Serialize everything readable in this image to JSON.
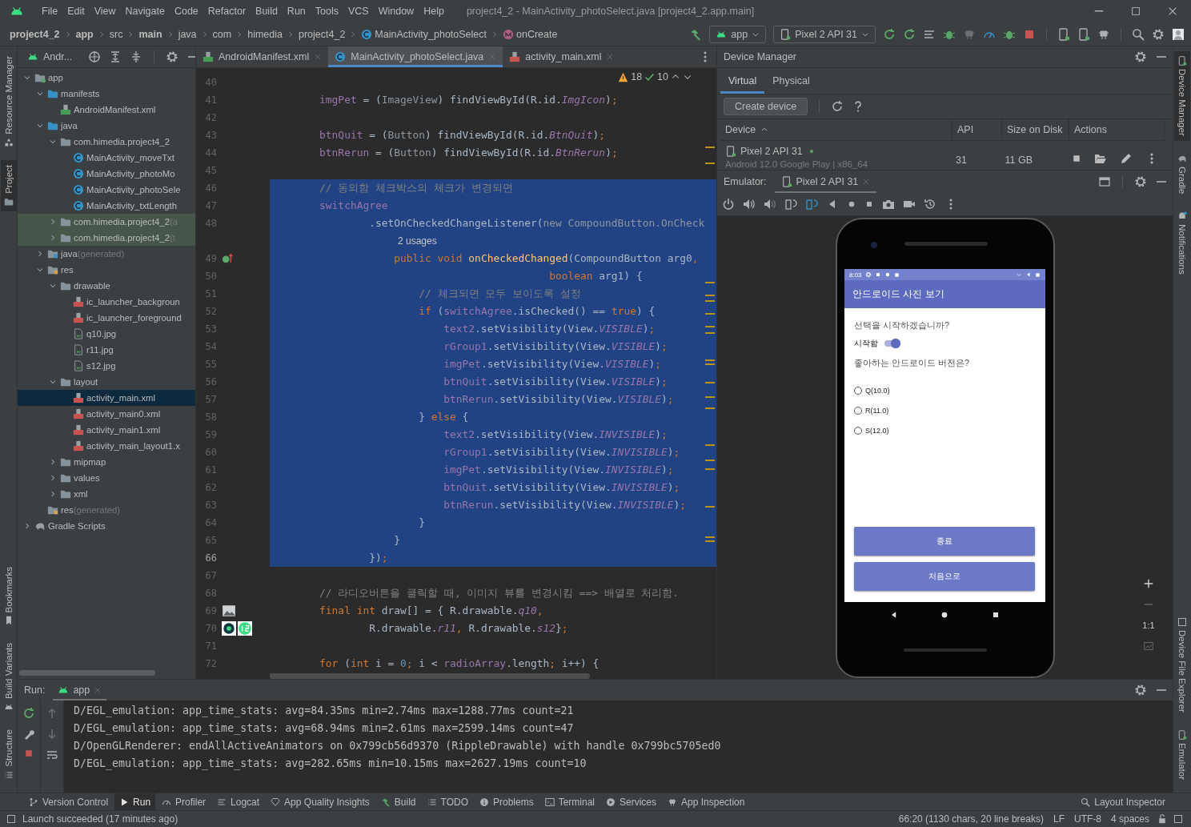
{
  "window": {
    "title": "project4_2 - MainActivity_photoSelect.java [project4_2.app.main]"
  },
  "menu": [
    "File",
    "Edit",
    "View",
    "Navigate",
    "Code",
    "Refactor",
    "Build",
    "Run",
    "Tools",
    "VCS",
    "Window",
    "Help"
  ],
  "breadcrumbs": [
    {
      "kind": "project",
      "label": "project4_2"
    },
    {
      "kind": "folder",
      "label": "app"
    },
    {
      "kind": "folder",
      "label": "src"
    },
    {
      "kind": "folder",
      "label": "main"
    },
    {
      "kind": "folder",
      "label": "java"
    },
    {
      "kind": "folder",
      "label": "com"
    },
    {
      "kind": "folder",
      "label": "himedia"
    },
    {
      "kind": "folder",
      "label": "project4_2"
    },
    {
      "kind": "class",
      "label": "MainActivity_photoSelect"
    },
    {
      "kind": "method",
      "label": "onCreate"
    }
  ],
  "toolbar": {
    "run_config": "app",
    "device": "Pixel 2 API 31"
  },
  "left_stripe": [
    {
      "label": "Resource Manager",
      "selected": false
    },
    {
      "label": "Project",
      "selected": true
    },
    {
      "label": "Bookmarks",
      "selected": false
    },
    {
      "label": "Build Variants",
      "selected": false
    },
    {
      "label": "Structure",
      "selected": false
    }
  ],
  "right_stripe": [
    {
      "label": "Device Manager",
      "selected": true
    },
    {
      "label": "Gradle",
      "selected": false
    },
    {
      "label": "Notifications",
      "selected": false
    },
    {
      "label": "Device File Explorer",
      "selected": false
    },
    {
      "label": "Emulator",
      "selected": false
    }
  ],
  "project": {
    "title": "Andr...",
    "tree": [
      {
        "label": "app",
        "kind": "module",
        "expanded": true,
        "selected": false,
        "children": [
          {
            "label": "manifests",
            "kind": "source-folder",
            "expanded": true,
            "selected": false,
            "children": [
              {
                "label": "AndroidManifest.xml",
                "kind": "manifest",
                "selected": false
              }
            ]
          },
          {
            "label": "java",
            "kind": "source-folder",
            "expanded": true,
            "selected": false,
            "children": [
              {
                "label": "com.himedia.project4_2",
                "kind": "package",
                "expanded": true,
                "selected": false,
                "tinted": false,
                "children": [
                  {
                    "label": "MainActivity_moveTxt",
                    "kind": "class",
                    "selected": false
                  },
                  {
                    "label": "MainActivity_photoMo",
                    "kind": "class",
                    "selected": false
                  },
                  {
                    "label": "MainActivity_photoSele",
                    "kind": "class",
                    "selected": false
                  },
                  {
                    "label": "MainActivity_txtLength",
                    "kind": "class",
                    "selected": false
                  }
                ]
              },
              {
                "label": "com.himedia.project4_2",
                "hint": "(a",
                "kind": "package",
                "expanded": false,
                "selected": false,
                "tinted": true
              },
              {
                "label": "com.himedia.project4_2",
                "hint": "(t",
                "kind": "package",
                "expanded": false,
                "selected": false,
                "tinted": true
              }
            ]
          },
          {
            "label": "java",
            "hint": "(generated)",
            "kind": "generated-folder",
            "expanded": false,
            "selected": false
          },
          {
            "label": "res",
            "kind": "res-folder",
            "expanded": true,
            "selected": false,
            "children": [
              {
                "label": "drawable",
                "kind": "package",
                "expanded": true,
                "selected": false,
                "children": [
                  {
                    "label": "ic_launcher_backgroun",
                    "kind": "layout-file",
                    "selected": false
                  },
                  {
                    "label": "ic_launcher_foreground",
                    "kind": "layout-file",
                    "selected": false
                  },
                  {
                    "label": "q10.jpg",
                    "kind": "image-file",
                    "selected": false
                  },
                  {
                    "label": "r11.jpg",
                    "kind": "image-file",
                    "selected": false
                  },
                  {
                    "label": "s12.jpg",
                    "kind": "image-file",
                    "selected": false
                  }
                ]
              },
              {
                "label": "layout",
                "kind": "package",
                "expanded": true,
                "selected": false,
                "children": [
                  {
                    "label": "activity_main.xml",
                    "kind": "layout-file",
                    "selected": true
                  },
                  {
                    "label": "activity_main0.xml",
                    "kind": "layout-file",
                    "selected": false
                  },
                  {
                    "label": "activity_main1.xml",
                    "kind": "layout-file",
                    "selected": false
                  },
                  {
                    "label": "activity_main_layout1.x",
                    "kind": "layout-file",
                    "selected": false
                  }
                ]
              },
              {
                "label": "mipmap",
                "kind": "package",
                "expanded": false,
                "selected": false
              },
              {
                "label": "values",
                "kind": "package",
                "expanded": false,
                "selected": false
              },
              {
                "label": "xml",
                "kind": "package",
                "expanded": false,
                "selected": false
              }
            ]
          },
          {
            "label": "res",
            "hint": "(generated)",
            "kind": "res-folder",
            "selected": false
          }
        ]
      },
      {
        "label": "Gradle Scripts",
        "kind": "gradle",
        "expanded": false,
        "selected": false
      }
    ]
  },
  "editor": {
    "tabs": [
      {
        "label": "AndroidManifest.xml",
        "kind": "manifest",
        "selected": false
      },
      {
        "label": "MainActivity_photoSelect.java",
        "kind": "class",
        "selected": true
      },
      {
        "label": "activity_main.xml",
        "kind": "layout-file",
        "selected": false
      }
    ],
    "inspection": {
      "warnings": "18",
      "weak_warnings": "10"
    },
    "lines": [
      {
        "kind": "code",
        "number": "40",
        "selected": false
      },
      {
        "kind": "code",
        "number": "41",
        "selected": false,
        "tokens": [
          {
            "kind": "field",
            "text": "        imgPet"
          },
          {
            "kind": "plain",
            "text": " = ("
          },
          {
            "kind": "muted",
            "text": "ImageView"
          },
          {
            "kind": "plain",
            "text": ") findViewById(R.id."
          },
          {
            "kind": "constant",
            "text": "ImgIcon"
          },
          {
            "kind": "plain",
            "text": ")"
          },
          {
            "kind": "keyword",
            "text": ";"
          }
        ]
      },
      {
        "kind": "code",
        "number": "42",
        "selected": false
      },
      {
        "kind": "code",
        "number": "43",
        "selected": false,
        "tokens": [
          {
            "kind": "field",
            "text": "        btnQuit"
          },
          {
            "kind": "plain",
            "text": " = ("
          },
          {
            "kind": "muted",
            "text": "Button"
          },
          {
            "kind": "plain",
            "text": ") findViewById(R.id."
          },
          {
            "kind": "constant",
            "text": "BtnQuit"
          },
          {
            "kind": "plain",
            "text": ")"
          },
          {
            "kind": "keyword",
            "text": ";"
          }
        ]
      },
      {
        "kind": "code",
        "number": "44",
        "selected": false,
        "tokens": [
          {
            "kind": "field",
            "text": "        btnRerun"
          },
          {
            "kind": "plain",
            "text": " = ("
          },
          {
            "kind": "muted",
            "text": "Button"
          },
          {
            "kind": "plain",
            "text": ") findViewById(R.id."
          },
          {
            "kind": "constant",
            "text": "BtnRerun"
          },
          {
            "kind": "plain",
            "text": ")"
          },
          {
            "kind": "keyword",
            "text": ";"
          }
        ]
      },
      {
        "kind": "code",
        "number": "45",
        "selected": false
      },
      {
        "kind": "code",
        "number": "46",
        "selected": true,
        "tokens": [
          {
            "kind": "comment",
            "text": "        // 동의함 체크박스의 체크가 변경되면"
          }
        ]
      },
      {
        "kind": "code",
        "number": "47",
        "selected": true,
        "tokens": [
          {
            "kind": "field",
            "text": "        switchAgree"
          }
        ]
      },
      {
        "kind": "code",
        "number": "48",
        "selected": true,
        "tokens": [
          {
            "kind": "plain",
            "text": "                .setOnCheckedChangeListener("
          },
          {
            "kind": "muted",
            "text": "new CompoundButton.OnCheck"
          }
        ]
      },
      {
        "kind": "inlay",
        "text": "2 usages",
        "selected": true
      },
      {
        "kind": "code",
        "number": "49",
        "selected": true,
        "tokens": [
          {
            "kind": "keyword",
            "text": "                    public void "
          },
          {
            "kind": "method",
            "text": "onCheckedChanged"
          },
          {
            "kind": "plain",
            "text": "(CompoundButton arg0"
          },
          {
            "kind": "keyword",
            "text": ","
          }
        ]
      },
      {
        "kind": "code",
        "number": "50",
        "selected": true,
        "tokens": [
          {
            "kind": "keyword",
            "text": "                                             boolean "
          },
          {
            "kind": "plain",
            "text": "arg1) {"
          }
        ]
      },
      {
        "kind": "code",
        "number": "51",
        "selected": true,
        "tokens": [
          {
            "kind": "comment",
            "text": "                        // 체크되면 모두 보이도록 설정"
          }
        ]
      },
      {
        "kind": "code",
        "number": "52",
        "selected": true,
        "tokens": [
          {
            "kind": "keyword",
            "text": "                        if "
          },
          {
            "kind": "plain",
            "text": "("
          },
          {
            "kind": "field",
            "text": "switchAgree"
          },
          {
            "kind": "plain",
            "text": ".isChecked() == "
          },
          {
            "kind": "keyword",
            "text": "true"
          },
          {
            "kind": "plain",
            "text": ") {"
          }
        ]
      },
      {
        "kind": "code",
        "number": "53",
        "selected": true,
        "tokens": [
          {
            "kind": "field",
            "text": "                            text2"
          },
          {
            "kind": "plain",
            "text": ".setVisibility(View."
          },
          {
            "kind": "constant",
            "text": "VISIBLE"
          },
          {
            "kind": "plain",
            "text": ")"
          },
          {
            "kind": "keyword",
            "text": ";"
          }
        ]
      },
      {
        "kind": "code",
        "number": "54",
        "selected": true,
        "tokens": [
          {
            "kind": "field",
            "text": "                            rGroup1"
          },
          {
            "kind": "plain",
            "text": ".setVisibility(View."
          },
          {
            "kind": "constant",
            "text": "VISIBLE"
          },
          {
            "kind": "plain",
            "text": ")"
          },
          {
            "kind": "keyword",
            "text": ";"
          }
        ]
      },
      {
        "kind": "code",
        "number": "55",
        "selected": true,
        "tokens": [
          {
            "kind": "field",
            "text": "                            imgPet"
          },
          {
            "kind": "plain",
            "text": ".setVisibility(View."
          },
          {
            "kind": "constant",
            "text": "VISIBLE"
          },
          {
            "kind": "plain",
            "text": ")"
          },
          {
            "kind": "keyword",
            "text": ";"
          }
        ]
      },
      {
        "kind": "code",
        "number": "56",
        "selected": true,
        "tokens": [
          {
            "kind": "field",
            "text": "                            btnQuit"
          },
          {
            "kind": "plain",
            "text": ".setVisibility(View."
          },
          {
            "kind": "constant",
            "text": "VISIBLE"
          },
          {
            "kind": "plain",
            "text": ")"
          },
          {
            "kind": "keyword",
            "text": ";"
          }
        ]
      },
      {
        "kind": "code",
        "number": "57",
        "selected": true,
        "tokens": [
          {
            "kind": "field",
            "text": "                            btnRerun"
          },
          {
            "kind": "plain",
            "text": ".setVisibility(View."
          },
          {
            "kind": "constant",
            "text": "VISIBLE"
          },
          {
            "kind": "plain",
            "text": ")"
          },
          {
            "kind": "keyword",
            "text": ";"
          }
        ]
      },
      {
        "kind": "code",
        "number": "58",
        "selected": true,
        "tokens": [
          {
            "kind": "plain",
            "text": "                        } "
          },
          {
            "kind": "keyword",
            "text": "else "
          },
          {
            "kind": "plain",
            "text": "{"
          }
        ]
      },
      {
        "kind": "code",
        "number": "59",
        "selected": true,
        "tokens": [
          {
            "kind": "field",
            "text": "                            text2"
          },
          {
            "kind": "plain",
            "text": ".setVisibility(View."
          },
          {
            "kind": "constant",
            "text": "INVISIBLE"
          },
          {
            "kind": "plain",
            "text": ")"
          },
          {
            "kind": "keyword",
            "text": ";"
          }
        ]
      },
      {
        "kind": "code",
        "number": "60",
        "selected": true,
        "tokens": [
          {
            "kind": "field",
            "text": "                            rGroup1"
          },
          {
            "kind": "plain",
            "text": ".setVisibility(View."
          },
          {
            "kind": "constant",
            "text": "INVISIBLE"
          },
          {
            "kind": "plain",
            "text": ")"
          },
          {
            "kind": "keyword",
            "text": ";"
          }
        ]
      },
      {
        "kind": "code",
        "number": "61",
        "selected": true,
        "tokens": [
          {
            "kind": "field",
            "text": "                            imgPet"
          },
          {
            "kind": "plain",
            "text": ".setVisibility(View."
          },
          {
            "kind": "constant",
            "text": "INVISIBLE"
          },
          {
            "kind": "plain",
            "text": ")"
          },
          {
            "kind": "keyword",
            "text": ";"
          }
        ]
      },
      {
        "kind": "code",
        "number": "62",
        "selected": true,
        "tokens": [
          {
            "kind": "field",
            "text": "                            btnQuit"
          },
          {
            "kind": "plain",
            "text": ".setVisibility(View."
          },
          {
            "kind": "constant",
            "text": "INVISIBLE"
          },
          {
            "kind": "plain",
            "text": ")"
          },
          {
            "kind": "keyword",
            "text": ";"
          }
        ]
      },
      {
        "kind": "code",
        "number": "63",
        "selected": true,
        "tokens": [
          {
            "kind": "field",
            "text": "                            btnRerun"
          },
          {
            "kind": "plain",
            "text": ".setVisibility(View."
          },
          {
            "kind": "constant",
            "text": "INVISIBLE"
          },
          {
            "kind": "plain",
            "text": ")"
          },
          {
            "kind": "keyword",
            "text": ";"
          }
        ]
      },
      {
        "kind": "code",
        "number": "64",
        "selected": true,
        "tokens": [
          {
            "kind": "plain",
            "text": "                        }"
          }
        ]
      },
      {
        "kind": "code",
        "number": "65",
        "selected": true,
        "tokens": [
          {
            "kind": "plain",
            "text": "                    }"
          }
        ]
      },
      {
        "kind": "code",
        "number": "66",
        "selected": true,
        "tokens": [
          {
            "kind": "plain",
            "text": "                })"
          },
          {
            "kind": "keyword",
            "text": ";"
          }
        ]
      },
      {
        "kind": "code",
        "number": "67",
        "selected": false
      },
      {
        "kind": "code",
        "number": "68",
        "selected": false,
        "tokens": [
          {
            "kind": "comment",
            "text": "        // 라디오버튼을 클릭할 때, 이미지 뷰를 변경시킴 ==> 배열로 처리함."
          }
        ]
      },
      {
        "kind": "code",
        "number": "69",
        "selected": false,
        "tokens": [
          {
            "kind": "keyword",
            "text": "        final int "
          },
          {
            "kind": "plain",
            "text": "draw[] = { R.drawable."
          },
          {
            "kind": "constant",
            "text": "q10"
          },
          {
            "kind": "keyword",
            "text": ","
          }
        ]
      },
      {
        "kind": "code",
        "number": "70",
        "selected": false,
        "tokens": [
          {
            "kind": "plain",
            "text": "                R.drawable."
          },
          {
            "kind": "constant",
            "text": "r11"
          },
          {
            "kind": "keyword",
            "text": ", "
          },
          {
            "kind": "plain",
            "text": "R.drawable."
          },
          {
            "kind": "constant",
            "text": "s12"
          },
          {
            "kind": "plain",
            "text": "}"
          },
          {
            "kind": "keyword",
            "text": ";"
          }
        ]
      },
      {
        "kind": "code",
        "number": "71",
        "selected": false
      },
      {
        "kind": "code",
        "number": "72",
        "selected": false,
        "tokens": [
          {
            "kind": "keyword",
            "text": "        for "
          },
          {
            "kind": "plain",
            "text": "("
          },
          {
            "kind": "keyword",
            "text": "int "
          },
          {
            "kind": "plain",
            "text": "i = "
          },
          {
            "kind": "number",
            "text": "0"
          },
          {
            "kind": "keyword",
            "text": "; "
          },
          {
            "kind": "plain",
            "text": "i < "
          },
          {
            "kind": "field",
            "text": "radioArray"
          },
          {
            "kind": "plain",
            "text": ".length"
          },
          {
            "kind": "keyword",
            "text": "; "
          },
          {
            "kind": "plain",
            "text": "i++) {"
          }
        ]
      }
    ]
  },
  "device_manager": {
    "title": "Device Manager",
    "tabs": [
      {
        "label": "Virtual",
        "selected": true
      },
      {
        "label": "Physical",
        "selected": false
      }
    ],
    "create_button": "Create device",
    "columns": [
      "Device",
      "API",
      "Size on Disk",
      "Actions"
    ],
    "devices": [
      {
        "name": "Pixel 2 API 31",
        "online": true,
        "subtitle": "Android 12.0 Google Play | x86_64",
        "api": "31",
        "size": "11 GB"
      }
    ]
  },
  "emulator": {
    "label": "Emulator:",
    "tab": "Pixel 2 API 31",
    "zoom_label": "1:1",
    "screen": {
      "time": "8:03",
      "title": "안드로이드 사진 보기",
      "question": "선택을 시작하겠습니까?",
      "switch": {
        "label": "시작함",
        "on": true
      },
      "question2": "좋아하는 안드로이드 버전은?",
      "options": [
        {
          "label": "Q(10.0)",
          "selected": false
        },
        {
          "label": "R(11.0)",
          "selected": false
        },
        {
          "label": "S(12.0)",
          "selected": false
        }
      ],
      "buttons": [
        "종료",
        "처음으로"
      ]
    }
  },
  "run": {
    "title": "Run:",
    "tab": "app",
    "console": [
      "D/EGL_emulation: app_time_stats: avg=84.35ms min=2.74ms max=1288.77ms count=21",
      "D/EGL_emulation: app_time_stats: avg=68.94ms min=2.61ms max=2599.14ms count=47",
      "D/OpenGLRenderer: endAllActiveAnimators on 0x799cb56d9370 (RippleDrawable) with handle 0x799bc5705ed0",
      "D/EGL_emulation: app_time_stats: avg=282.65ms min=10.15ms max=2627.19ms count=10"
    ]
  },
  "tool_windows": [
    {
      "label": "Version Control",
      "selected": false
    },
    {
      "label": "Run",
      "selected": true
    },
    {
      "label": "Profiler",
      "selected": false
    },
    {
      "label": "Logcat",
      "selected": false
    },
    {
      "label": "App Quality Insights",
      "selected": false
    },
    {
      "label": "Build",
      "selected": false
    },
    {
      "label": "TODO",
      "selected": false
    },
    {
      "label": "Problems",
      "selected": false
    },
    {
      "label": "Terminal",
      "selected": false
    },
    {
      "label": "Services",
      "selected": false
    },
    {
      "label": "App Inspection",
      "selected": false
    }
  ],
  "layout_inspector": "Layout Inspector",
  "status_bar": {
    "message": "Launch succeeded (17 minutes ago)",
    "position": "66:20 (1130 chars, 20 line breaks)",
    "line_separator": "LF",
    "encoding": "UTF-8",
    "indent": "4 spaces"
  }
}
